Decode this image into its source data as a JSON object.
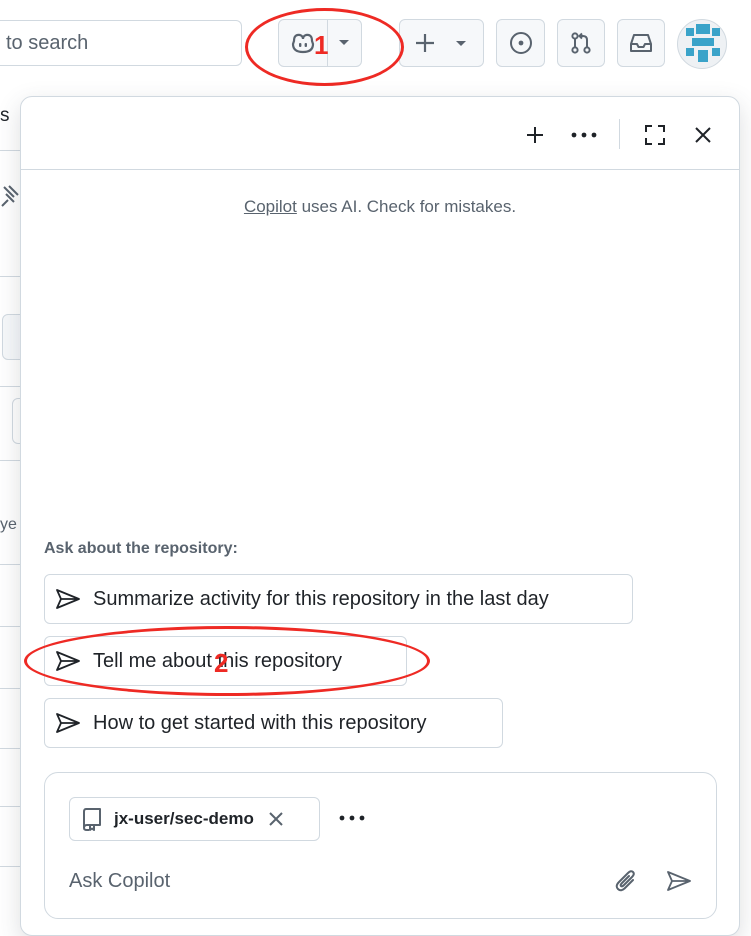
{
  "header": {
    "search_placeholder": "to search",
    "copilot_button": "copilot-icon",
    "create_button": "plus-icon",
    "issues_button": "issue-opened-icon",
    "pulls_button": "git-pull-request-icon",
    "inbox_button": "inbox-icon",
    "avatar": "identicon"
  },
  "background": {
    "fragment_s": "s",
    "fragment_ye": "ye"
  },
  "panel": {
    "toolbar": {
      "new_chat": "plus-icon",
      "more": "kebab-horizontal-icon",
      "expand": "screen-full-icon",
      "close": "x-icon"
    },
    "notice": {
      "link": "Copilot",
      "text": " uses AI. Check for mistakes."
    },
    "ask_heading": "Ask about the repository:",
    "suggestions": [
      "Summarize activity for this repository in the last day",
      "Tell me about this repository",
      "How to get started with this repository"
    ],
    "composer": {
      "repo_chip": "jx-user/sec-demo",
      "placeholder": "Ask Copilot"
    }
  },
  "annotations": {
    "one": "1",
    "two": "2"
  },
  "colors": {
    "annotation": "#ee2a24",
    "border": "#d1d9e0",
    "muted_text": "#59636e",
    "avatar_blue": "#3aa3c9"
  }
}
